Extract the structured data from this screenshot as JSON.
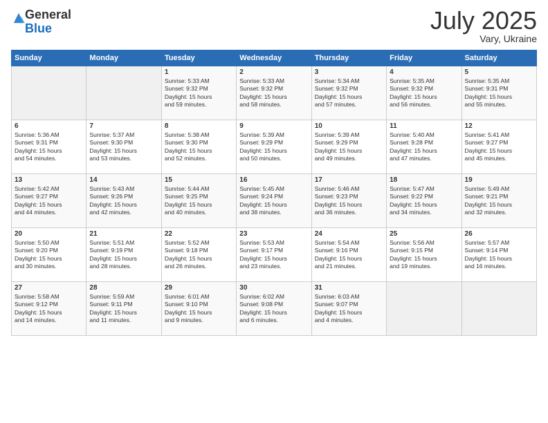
{
  "logo": {
    "general": "General",
    "blue": "Blue"
  },
  "title": "July 2025",
  "subtitle": "Vary, Ukraine",
  "days_header": [
    "Sunday",
    "Monday",
    "Tuesday",
    "Wednesday",
    "Thursday",
    "Friday",
    "Saturday"
  ],
  "weeks": [
    [
      {
        "day": "",
        "info": ""
      },
      {
        "day": "",
        "info": ""
      },
      {
        "day": "1",
        "info": "Sunrise: 5:33 AM\nSunset: 9:32 PM\nDaylight: 15 hours\nand 59 minutes."
      },
      {
        "day": "2",
        "info": "Sunrise: 5:33 AM\nSunset: 9:32 PM\nDaylight: 15 hours\nand 58 minutes."
      },
      {
        "day": "3",
        "info": "Sunrise: 5:34 AM\nSunset: 9:32 PM\nDaylight: 15 hours\nand 57 minutes."
      },
      {
        "day": "4",
        "info": "Sunrise: 5:35 AM\nSunset: 9:32 PM\nDaylight: 15 hours\nand 56 minutes."
      },
      {
        "day": "5",
        "info": "Sunrise: 5:35 AM\nSunset: 9:31 PM\nDaylight: 15 hours\nand 55 minutes."
      }
    ],
    [
      {
        "day": "6",
        "info": "Sunrise: 5:36 AM\nSunset: 9:31 PM\nDaylight: 15 hours\nand 54 minutes."
      },
      {
        "day": "7",
        "info": "Sunrise: 5:37 AM\nSunset: 9:30 PM\nDaylight: 15 hours\nand 53 minutes."
      },
      {
        "day": "8",
        "info": "Sunrise: 5:38 AM\nSunset: 9:30 PM\nDaylight: 15 hours\nand 52 minutes."
      },
      {
        "day": "9",
        "info": "Sunrise: 5:39 AM\nSunset: 9:29 PM\nDaylight: 15 hours\nand 50 minutes."
      },
      {
        "day": "10",
        "info": "Sunrise: 5:39 AM\nSunset: 9:29 PM\nDaylight: 15 hours\nand 49 minutes."
      },
      {
        "day": "11",
        "info": "Sunrise: 5:40 AM\nSunset: 9:28 PM\nDaylight: 15 hours\nand 47 minutes."
      },
      {
        "day": "12",
        "info": "Sunrise: 5:41 AM\nSunset: 9:27 PM\nDaylight: 15 hours\nand 45 minutes."
      }
    ],
    [
      {
        "day": "13",
        "info": "Sunrise: 5:42 AM\nSunset: 9:27 PM\nDaylight: 15 hours\nand 44 minutes."
      },
      {
        "day": "14",
        "info": "Sunrise: 5:43 AM\nSunset: 9:26 PM\nDaylight: 15 hours\nand 42 minutes."
      },
      {
        "day": "15",
        "info": "Sunrise: 5:44 AM\nSunset: 9:25 PM\nDaylight: 15 hours\nand 40 minutes."
      },
      {
        "day": "16",
        "info": "Sunrise: 5:45 AM\nSunset: 9:24 PM\nDaylight: 15 hours\nand 38 minutes."
      },
      {
        "day": "17",
        "info": "Sunrise: 5:46 AM\nSunset: 9:23 PM\nDaylight: 15 hours\nand 36 minutes."
      },
      {
        "day": "18",
        "info": "Sunrise: 5:47 AM\nSunset: 9:22 PM\nDaylight: 15 hours\nand 34 minutes."
      },
      {
        "day": "19",
        "info": "Sunrise: 5:49 AM\nSunset: 9:21 PM\nDaylight: 15 hours\nand 32 minutes."
      }
    ],
    [
      {
        "day": "20",
        "info": "Sunrise: 5:50 AM\nSunset: 9:20 PM\nDaylight: 15 hours\nand 30 minutes."
      },
      {
        "day": "21",
        "info": "Sunrise: 5:51 AM\nSunset: 9:19 PM\nDaylight: 15 hours\nand 28 minutes."
      },
      {
        "day": "22",
        "info": "Sunrise: 5:52 AM\nSunset: 9:18 PM\nDaylight: 15 hours\nand 26 minutes."
      },
      {
        "day": "23",
        "info": "Sunrise: 5:53 AM\nSunset: 9:17 PM\nDaylight: 15 hours\nand 23 minutes."
      },
      {
        "day": "24",
        "info": "Sunrise: 5:54 AM\nSunset: 9:16 PM\nDaylight: 15 hours\nand 21 minutes."
      },
      {
        "day": "25",
        "info": "Sunrise: 5:56 AM\nSunset: 9:15 PM\nDaylight: 15 hours\nand 19 minutes."
      },
      {
        "day": "26",
        "info": "Sunrise: 5:57 AM\nSunset: 9:14 PM\nDaylight: 15 hours\nand 16 minutes."
      }
    ],
    [
      {
        "day": "27",
        "info": "Sunrise: 5:58 AM\nSunset: 9:12 PM\nDaylight: 15 hours\nand 14 minutes."
      },
      {
        "day": "28",
        "info": "Sunrise: 5:59 AM\nSunset: 9:11 PM\nDaylight: 15 hours\nand 11 minutes."
      },
      {
        "day": "29",
        "info": "Sunrise: 6:01 AM\nSunset: 9:10 PM\nDaylight: 15 hours\nand 9 minutes."
      },
      {
        "day": "30",
        "info": "Sunrise: 6:02 AM\nSunset: 9:08 PM\nDaylight: 15 hours\nand 6 minutes."
      },
      {
        "day": "31",
        "info": "Sunrise: 6:03 AM\nSunset: 9:07 PM\nDaylight: 15 hours\nand 4 minutes."
      },
      {
        "day": "",
        "info": ""
      },
      {
        "day": "",
        "info": ""
      }
    ]
  ]
}
